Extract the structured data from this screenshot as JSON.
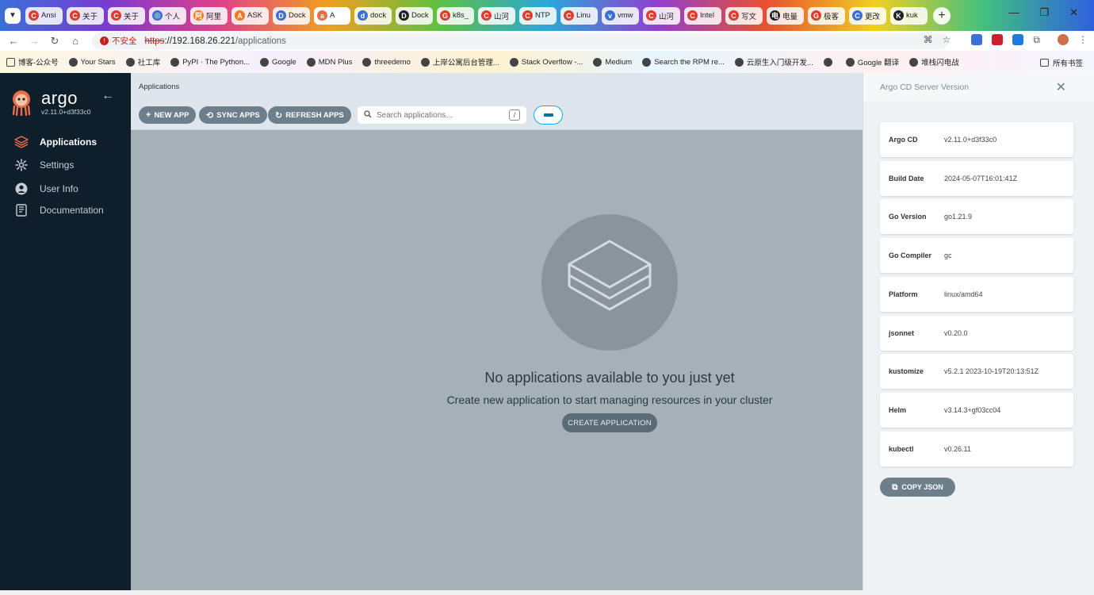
{
  "browser": {
    "tabs": [
      {
        "label": "Ansi",
        "fav": "C"
      },
      {
        "label": "关于",
        "fav": "C"
      },
      {
        "label": "关于",
        "fav": "C"
      },
      {
        "label": "个人",
        "fav": "◎"
      },
      {
        "label": "阿里",
        "fav": "阿"
      },
      {
        "label": "ASK",
        "fav": "A"
      },
      {
        "label": "Dock",
        "fav": "D"
      },
      {
        "label": "A",
        "fav": "a"
      },
      {
        "label": "dock",
        "fav": "d"
      },
      {
        "label": "Dock",
        "fav": "D"
      },
      {
        "label": "k8s_",
        "fav": "G"
      },
      {
        "label": "山河",
        "fav": "C"
      },
      {
        "label": "NTP",
        "fav": "C"
      },
      {
        "label": "Linu",
        "fav": "C"
      },
      {
        "label": "vmw",
        "fav": "v"
      },
      {
        "label": "山河",
        "fav": "C"
      },
      {
        "label": "Intel",
        "fav": "C"
      },
      {
        "label": "写文",
        "fav": "C"
      },
      {
        "label": "电量",
        "fav": "电"
      },
      {
        "label": "极客",
        "fav": "G"
      },
      {
        "label": "更改",
        "fav": "C"
      },
      {
        "label": "kuk",
        "fav": "K"
      }
    ],
    "new_tab": "+",
    "window_controls": [
      "—",
      "❐",
      "✕"
    ],
    "security_label": "不安全",
    "url_scheme": "https",
    "url_host": "://192.168.26.221",
    "url_path": "/applications",
    "bookmarks": [
      "博客-公众号",
      "Your Stars",
      "社工库",
      "PyPI · The Python...",
      "Google",
      "MDN Plus",
      "threedemo",
      "上岸公寓后台管理...",
      "Stack Overflow -...",
      "Medium",
      "Search the RPM re...",
      "云原生入门级开发...",
      "",
      "Google 翻译",
      "堆栈闪电战"
    ],
    "all_bookmarks": "所有书签"
  },
  "sidebar": {
    "brand": "argo",
    "version": "v2.11.0+d3f33c0",
    "items": [
      {
        "label": "Applications"
      },
      {
        "label": "Settings"
      },
      {
        "label": "User Info"
      },
      {
        "label": "Documentation"
      }
    ]
  },
  "main": {
    "breadcrumb": "Applications",
    "toolbar": {
      "new_app": "NEW APP",
      "sync_apps": "SYNC APPS",
      "refresh_apps": "REFRESH APPS",
      "search_placeholder": "Search applications...",
      "search_shortcut": "/"
    },
    "empty": {
      "title": "No applications available to you just yet",
      "subtitle": "Create new application to start managing resources in your cluster",
      "button": "CREATE APPLICATION"
    }
  },
  "panel": {
    "title": "Argo CD Server Version",
    "close": "✕",
    "rows": [
      {
        "key": "Argo CD",
        "value": "v2.11.0+d3f33c0"
      },
      {
        "key": "Build Date",
        "value": "2024-05-07T16:01:41Z"
      },
      {
        "key": "Go Version",
        "value": "go1.21.9"
      },
      {
        "key": "Go Compiler",
        "value": "gc"
      },
      {
        "key": "Platform",
        "value": "linux/amd64"
      },
      {
        "key": "jsonnet",
        "value": "v0.20.0"
      },
      {
        "key": "kustomize",
        "value": "v5.2.1 2023-10-19T20:13:51Z"
      },
      {
        "key": "Helm",
        "value": "v3.14.3+gf03cc04"
      },
      {
        "key": "kubectl",
        "value": "v0.26.11"
      }
    ],
    "copy_json": "COPY JSON"
  },
  "colors": {
    "sidebar_bg": "#0e1e2b",
    "overlay": "#a6b0b7",
    "button_bg": "#6d7f8b",
    "accent": "#0dadea",
    "argo_orange": "#e96d4b"
  }
}
